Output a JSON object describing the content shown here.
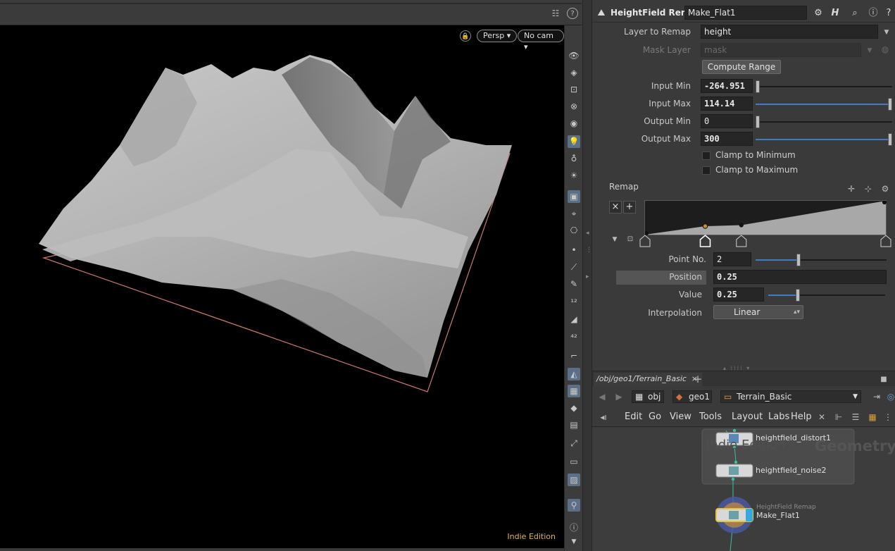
{
  "viewport": {
    "camera_mode": "Persp",
    "camera": "No cam",
    "edition_label": "Indie Edition"
  },
  "params": {
    "node_type": "HeightField Remap",
    "node_name": "Make_Flat1",
    "layer_to_remap": {
      "label": "Layer to Remap",
      "value": "height"
    },
    "mask_layer": {
      "label": "Mask Layer",
      "value": "mask"
    },
    "compute_range_label": "Compute Range",
    "input_min": {
      "label": "Input Min",
      "value": "-264.951",
      "fraction": 0.0
    },
    "input_max": {
      "label": "Input Max",
      "value": "114.14",
      "fraction": 1.0
    },
    "output_min": {
      "label": "Output Min",
      "value": "0",
      "fraction": 0.0
    },
    "output_max": {
      "label": "Output Max",
      "value": "300",
      "fraction": 1.0
    },
    "clamp_min_label": "Clamp to Minimum",
    "clamp_max_label": "Clamp to Maximum",
    "clamp_min_checked": false,
    "clamp_max_checked": false,
    "remap_label": "Remap",
    "ramp_points": [
      {
        "position": 0.0,
        "value": 0.0
      },
      {
        "position": 0.25,
        "value": 0.25
      },
      {
        "position": 0.4,
        "value": 0.28
      },
      {
        "position": 1.0,
        "value": 1.0
      }
    ],
    "point_no": {
      "label": "Point No.",
      "value": "2",
      "fraction": 0.33
    },
    "position": {
      "label": "Position",
      "value": "0.25"
    },
    "value": {
      "label": "Value",
      "value": "0.25",
      "fraction": 0.25
    },
    "interpolation": {
      "label": "Interpolation",
      "value": "Linear"
    }
  },
  "network": {
    "tab_label": "/obj/geo1/Terrain_Basic",
    "breadcrumbs": [
      "obj",
      "geo1",
      "Terrain_Basic"
    ],
    "menu": [
      "Edit",
      "Go",
      "View",
      "Tools",
      "Layout",
      "Labs",
      "Help"
    ],
    "watermark_left": "Indie Edition",
    "watermark_right": "Geometry",
    "nodes": [
      {
        "name": "heightfield_distort1"
      },
      {
        "name": "heightfield_noise2"
      },
      {
        "type": "HeightField Remap",
        "name": "Make_Flat1"
      }
    ]
  },
  "colors": {
    "accent": "#3e7bc4",
    "selected_node": "#e5c531",
    "edition": "#e0b84a"
  }
}
